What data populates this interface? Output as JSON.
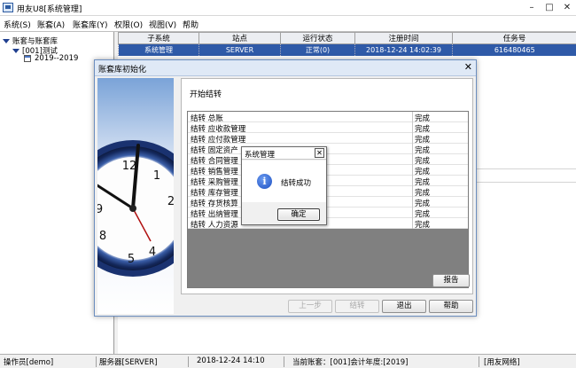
{
  "window": {
    "title": "用友U8[系统管理]",
    "controls": [
      "–",
      "□",
      "✕"
    ]
  },
  "menu": [
    "系统(S)",
    "账套(A)",
    "账套库(Y)",
    "权限(O)",
    "视图(V)",
    "帮助"
  ],
  "tree": {
    "root": "账套与账套库",
    "account": "[001]测试",
    "year": "2019--2019"
  },
  "grid": {
    "headers": [
      "子系统",
      "站点",
      "运行状态",
      "注册时间",
      "任务号"
    ],
    "row": [
      "系统管理",
      "SERVER",
      "正常(0)",
      "2018-12-24 14:02:39",
      "616480465"
    ]
  },
  "status": {
    "operator": "操作员[demo]",
    "server": "服务器[SERVER]",
    "datetime": "2018-12-24 14:10",
    "current": "当前账套：[001]会计年度:[2019]",
    "network": "[用友网络]"
  },
  "dialog": {
    "title": "账套库初始化",
    "close": "✕",
    "heading": "开始结转",
    "items": [
      {
        "label": "结转  总账",
        "status": "完成"
      },
      {
        "label": "结转  应收款管理",
        "status": "完成"
      },
      {
        "label": "结转  应付款管理",
        "status": "完成"
      },
      {
        "label": "结转  固定资产",
        "status": "完成"
      },
      {
        "label": "结转  合同管理",
        "status": "完成"
      },
      {
        "label": "结转  销售管理",
        "status": "完成"
      },
      {
        "label": "结转  采购管理",
        "status": "完成"
      },
      {
        "label": "结转  库存管理",
        "status": "完成"
      },
      {
        "label": "结转  存货核算",
        "status": "完成"
      },
      {
        "label": "结转  出纳管理",
        "status": "完成"
      },
      {
        "label": "结转  人力资源",
        "status": "完成"
      }
    ],
    "buttons": {
      "report": "报告",
      "prev": "上一步",
      "carry": "结转",
      "exit": "退出",
      "help": "帮助"
    }
  },
  "message": {
    "title": "系统管理",
    "close": "✕",
    "icon": "i",
    "text": "结转成功",
    "ok": "确定"
  }
}
